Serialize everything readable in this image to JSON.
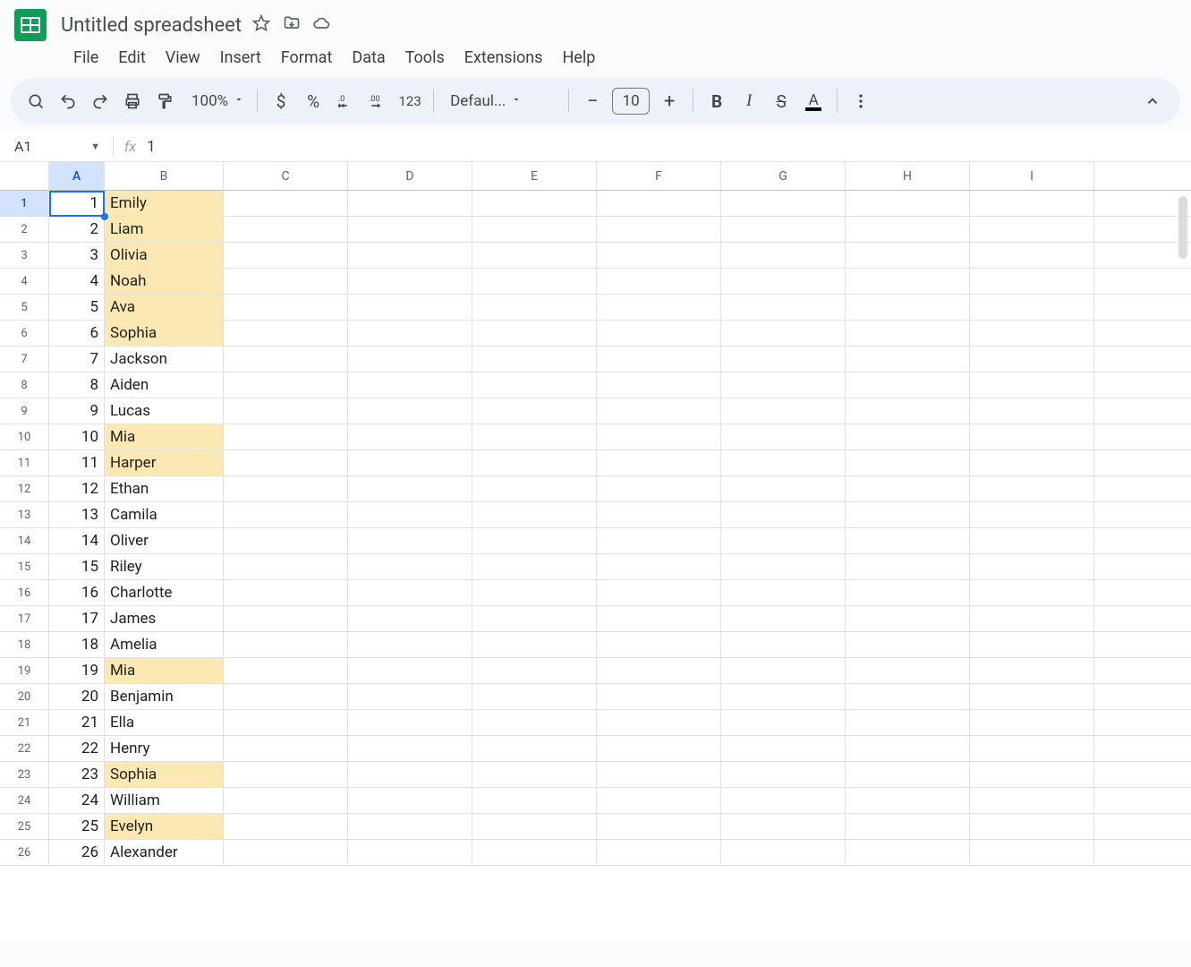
{
  "doc": {
    "title": "Untitled spreadsheet"
  },
  "menu": {
    "file": "File",
    "edit": "Edit",
    "view": "View",
    "insert": "Insert",
    "format": "Format",
    "data": "Data",
    "tools": "Tools",
    "extensions": "Extensions",
    "help": "Help"
  },
  "toolbar": {
    "zoom": "100%",
    "font": "Defaul...",
    "font_size": "10",
    "number_fmt": "123",
    "currency": "$",
    "percent": "%"
  },
  "namebox": {
    "ref": "A1"
  },
  "formula_bar": {
    "value": "1"
  },
  "columns": [
    "A",
    "B",
    "C",
    "D",
    "E",
    "F",
    "G",
    "H",
    "I"
  ],
  "active_col": "A",
  "active_row": 1,
  "rows": [
    {
      "n": "1",
      "a": "1",
      "b": "Emily",
      "hl": true
    },
    {
      "n": "2",
      "a": "2",
      "b": "Liam",
      "hl": true
    },
    {
      "n": "3",
      "a": "3",
      "b": "Olivia",
      "hl": true
    },
    {
      "n": "4",
      "a": "4",
      "b": "Noah",
      "hl": true
    },
    {
      "n": "5",
      "a": "5",
      "b": "Ava",
      "hl": true
    },
    {
      "n": "6",
      "a": "6",
      "b": "Sophia",
      "hl": true
    },
    {
      "n": "7",
      "a": "7",
      "b": "Jackson",
      "hl": false
    },
    {
      "n": "8",
      "a": "8",
      "b": "Aiden",
      "hl": false
    },
    {
      "n": "9",
      "a": "9",
      "b": "Lucas",
      "hl": false
    },
    {
      "n": "10",
      "a": "10",
      "b": "Mia",
      "hl": true
    },
    {
      "n": "11",
      "a": "11",
      "b": "Harper",
      "hl": true
    },
    {
      "n": "12",
      "a": "12",
      "b": "Ethan",
      "hl": false
    },
    {
      "n": "13",
      "a": "13",
      "b": "Camila",
      "hl": false
    },
    {
      "n": "14",
      "a": "14",
      "b": "Oliver",
      "hl": false
    },
    {
      "n": "15",
      "a": "15",
      "b": "Riley",
      "hl": false
    },
    {
      "n": "16",
      "a": "16",
      "b": "Charlotte",
      "hl": false
    },
    {
      "n": "17",
      "a": "17",
      "b": "James",
      "hl": false
    },
    {
      "n": "18",
      "a": "18",
      "b": "Amelia",
      "hl": false
    },
    {
      "n": "19",
      "a": "19",
      "b": "Mia",
      "hl": true
    },
    {
      "n": "20",
      "a": "20",
      "b": "Benjamin",
      "hl": false
    },
    {
      "n": "21",
      "a": "21",
      "b": "Ella",
      "hl": false
    },
    {
      "n": "22",
      "a": "22",
      "b": "Henry",
      "hl": false
    },
    {
      "n": "23",
      "a": "23",
      "b": "Sophia",
      "hl": true
    },
    {
      "n": "24",
      "a": "24",
      "b": "William",
      "hl": false
    },
    {
      "n": "25",
      "a": "25",
      "b": "Evelyn",
      "hl": true
    },
    {
      "n": "26",
      "a": "26",
      "b": "Alexander",
      "hl": false
    }
  ]
}
